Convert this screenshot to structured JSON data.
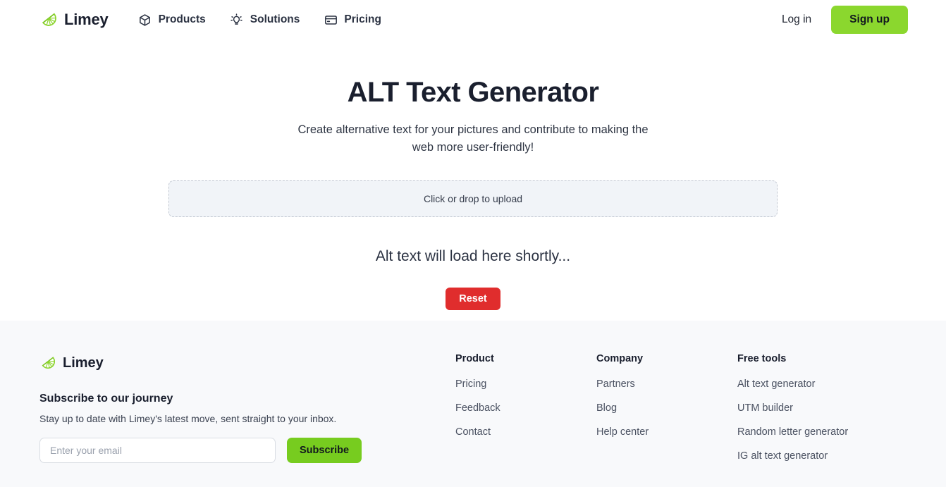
{
  "header": {
    "brand": {
      "name": "Limey",
      "icon": "lime-slice-icon"
    },
    "nav": [
      {
        "label": "Products",
        "icon": "cube-icon"
      },
      {
        "label": "Solutions",
        "icon": "lightbulb-icon"
      },
      {
        "label": "Pricing",
        "icon": "credit-card-icon"
      }
    ],
    "login_label": "Log in",
    "signup_label": "Sign up"
  },
  "main": {
    "title": "ALT Text Generator",
    "subtitle": "Create alternative text for your pictures and contribute to making the web more user-friendly!",
    "dropzone_label": "Click or drop to upload",
    "alt_status": "Alt text will load here shortly...",
    "reset_label": "Reset"
  },
  "footer": {
    "brand": {
      "name": "Limey",
      "icon": "lime-slice-icon"
    },
    "subscribe_title": "Subscribe to our journey",
    "subscribe_desc": "Stay up to date with Limey's latest move, sent straight to your inbox.",
    "email_placeholder": "Enter your email",
    "email_value": "",
    "subscribe_label": "Subscribe",
    "columns": [
      {
        "heading": "Product",
        "links": [
          "Pricing",
          "Feedback",
          "Contact"
        ]
      },
      {
        "heading": "Company",
        "links": [
          "Partners",
          "Blog",
          "Help center"
        ]
      },
      {
        "heading": "Free tools",
        "links": [
          "Alt text generator",
          "UTM builder",
          "Random letter generator",
          "IG alt text generator"
        ]
      }
    ]
  },
  "colors": {
    "brand_green": "#8bd72e",
    "subscribe_green": "#77cc1f",
    "reset_red": "#e02d2d",
    "footer_bg": "#f8f9fb",
    "dropzone_bg": "#f1f4f8",
    "text_dark": "#1a1f2e"
  }
}
